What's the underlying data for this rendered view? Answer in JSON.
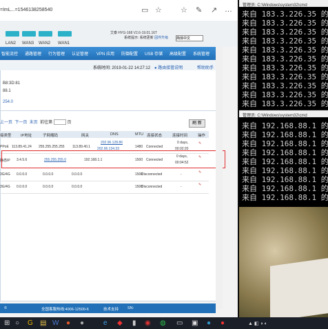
{
  "browser": {
    "url": "=ImL...=1546138258540",
    "ports": [
      "LAN2",
      "WAN3",
      "WAN2",
      "WAN1"
    ],
    "model": "艾泰 HYG-168 V2.6-19.01.16T",
    "firmware_info": "系统提示: 系统更新",
    "upgrade_link": "固件升级",
    "language": "简体中文",
    "nav": [
      "智能流控",
      "通路管理",
      "行为管理",
      "认证管理",
      "VPN 应用",
      "防御配置",
      "USB 存储",
      "高级配置",
      "系统管理"
    ],
    "system_time": "系统时间: 2019-01-22 14:27:12",
    "wizard": "路由接管说明",
    "help": "帮助助手",
    "info_lines": [
      "B8:3D:81",
      "88.1",
      "",
      "254.0"
    ],
    "pager": {
      "prev": "上一页",
      "next": "下一页",
      "last": "末页",
      "goto": "前往第",
      "page_unit": "页"
    },
    "refresh_label": "刷 新",
    "table": {
      "headers": [
        "接类型",
        "IP地址",
        "子网掩码",
        "网关",
        "DNS",
        "MTU",
        "连接状态",
        "连接时间",
        "操作"
      ],
      "rows": [
        {
          "type": "PPoE",
          "ip": "113.89.41.24",
          "mask": "255.255.255.255",
          "gw": "113.89.40.1",
          "dns1": "202.96.128.86",
          "dns2": "202.96.134.33",
          "mtu": "1480",
          "status": "Connected",
          "time1": "0 days,",
          "time2": "00:02:20"
        },
        {
          "type": "静态IP",
          "ip": "3.4.5.6",
          "mask": "255.255.255.0",
          "gw": "192.168.1.1",
          "dns1": "",
          "dns2": "",
          "mtu": "1500",
          "status": "Connected",
          "time1": "0 days,",
          "time2": "00:04:52"
        },
        {
          "type": "3G/4G",
          "ip": "0.0.0.0",
          "mask": "0.0.0.0",
          "gw": "0.0.0.0",
          "dns1": "",
          "dns2": "",
          "mtu": "1500",
          "status": "Disconnected",
          "time1": "-",
          "time2": ""
        },
        {
          "type": "3G/4G",
          "ip": "0.0.0.0",
          "mask": "0.0.0.0",
          "gw": "0.0.0.0",
          "dns1": "",
          "dns2": "",
          "mtu": "1500",
          "status": "Disconnected",
          "time1": "-",
          "time2": ""
        }
      ]
    },
    "footer": [
      "全国客服热线:4006-12500-6",
      "技术支持",
      "SN:"
    ]
  },
  "console_top": {
    "title": "管理员: C:\\Windows\\system32\\cmd",
    "lines": [
      "来自 183.3.226.35 的回复: 字",
      "来自 183.3.226.35 的回复: 字",
      "来自 183.3.226.35 的回复: 字",
      "来自 183.3.226.35 的回复: 字",
      "来自 183.3.226.35 的回复: 字",
      "来自 183.3.226.35 的回复: 字",
      "来自 183.3.226.35 的回复: 字",
      "来自 183.3.226.35 的回复: 字",
      "来自 183.3.226.35 的回复: 字",
      "来自 183.3.226.35 的回复: 字",
      "来自 183.3.226.35 的回复: 字"
    ]
  },
  "console_bottom": {
    "title": "管理员: C:\\Windows\\system32\\cmd",
    "lines": [
      "来自 192.168.88.1 的回复: 字",
      "来自 192.168.88.1 的回复: 字",
      "来自 192.168.88.1 的回复: 字",
      "来自 192.168.88.1 的回复: 字",
      "来自 192.168.88.1 的回复: 字",
      "来自 192.168.88.1 的回复: 字",
      "来自 192.168.88.1 的回复: 字",
      "来自 192.168.88.1 的回复: 字",
      "来自 192.168.88.1 的回复: 字"
    ]
  },
  "colors": {
    "accent": "#2170b8",
    "highlight": "#e02a2a",
    "port": "#2bb1c8"
  },
  "taskbar_icons": [
    "windows-icon",
    "search-icon",
    "chrome-icon",
    "explorer-icon",
    "word-icon",
    "edge-icon",
    "app-icon",
    "app-icon",
    "wechat-icon",
    "app-icon",
    "terminal-icon",
    "app-icon",
    "app-icon",
    "app-icon"
  ]
}
